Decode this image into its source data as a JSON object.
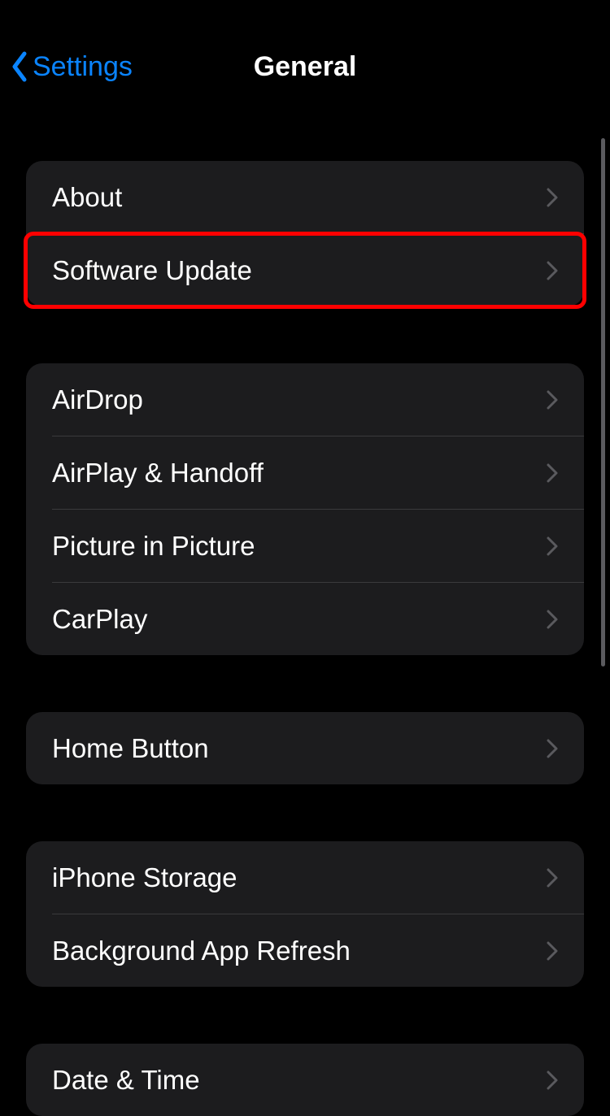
{
  "nav": {
    "back_label": "Settings",
    "title": "General"
  },
  "groups": [
    {
      "items": [
        {
          "label": "About",
          "highlight": false
        },
        {
          "label": "Software Update",
          "highlight": true
        }
      ]
    },
    {
      "items": [
        {
          "label": "AirDrop",
          "highlight": false
        },
        {
          "label": "AirPlay & Handoff",
          "highlight": false
        },
        {
          "label": "Picture in Picture",
          "highlight": false
        },
        {
          "label": "CarPlay",
          "highlight": false
        }
      ]
    },
    {
      "items": [
        {
          "label": "Home Button",
          "highlight": false
        }
      ]
    },
    {
      "items": [
        {
          "label": "iPhone Storage",
          "highlight": false
        },
        {
          "label": "Background App Refresh",
          "highlight": false
        }
      ]
    },
    {
      "items": [
        {
          "label": "Date & Time",
          "highlight": false
        }
      ]
    }
  ]
}
